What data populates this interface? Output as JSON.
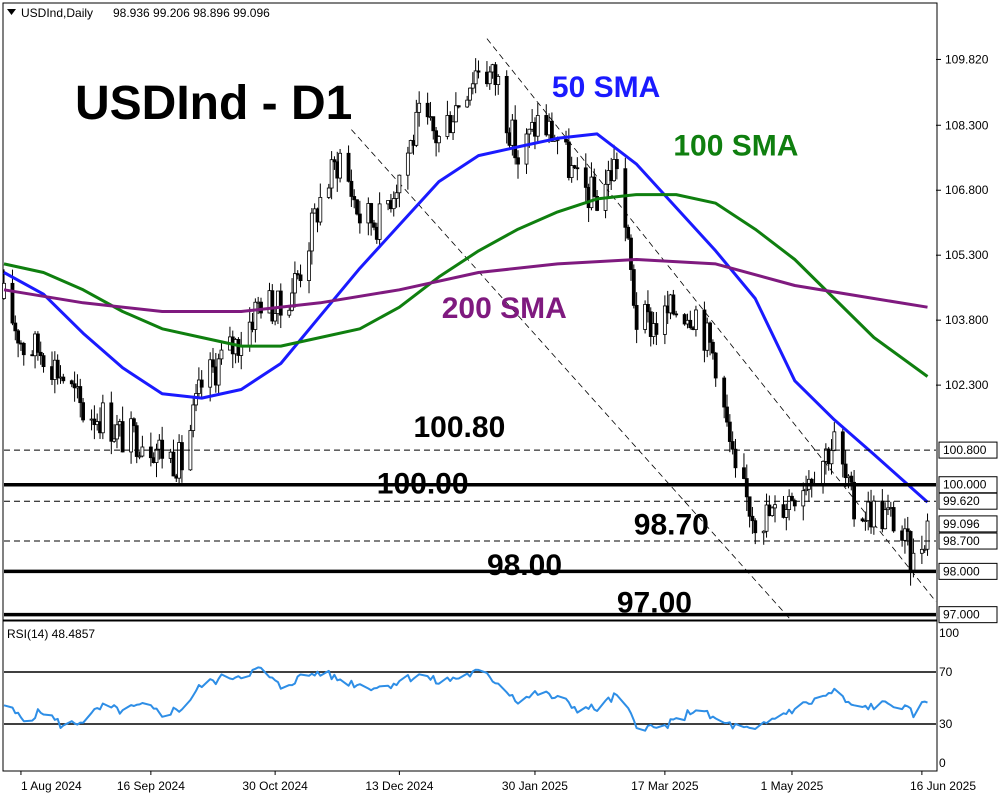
{
  "header": {
    "symbol_line": "USDInd,Daily",
    "ohlc": "98.936 99.206 98.896 99.096"
  },
  "title": "USDInd - D1",
  "colors": {
    "sma50": "#1a1aff",
    "sma100": "#0f7f0f",
    "sma200": "#7f1a7f",
    "rsi": "#2e8ee6",
    "candle": "#000000"
  },
  "chart_data": [
    {
      "type": "candlestick",
      "title": "USDInd - D1",
      "ylim": [
        96.9,
        111.1
      ],
      "y_ticks": [
        {
          "value": 109.82,
          "label": "109.820"
        },
        {
          "value": 108.3,
          "label": "108.300"
        },
        {
          "value": 106.8,
          "label": "106.800"
        },
        {
          "value": 105.3,
          "label": "105.300"
        },
        {
          "value": 103.8,
          "label": "103.800"
        },
        {
          "value": 102.3,
          "label": "102.300"
        }
      ],
      "level_boxes": [
        {
          "value": 100.8,
          "label": "100.800",
          "style": "dashed"
        },
        {
          "value": 100.0,
          "label": "100.000",
          "style": "thick"
        },
        {
          "value": 99.62,
          "label": "99.620",
          "style": "dashed"
        },
        {
          "value": 99.096,
          "label": "99.096",
          "style": "current"
        },
        {
          "value": 98.7,
          "label": "98.700",
          "style": "dashed"
        },
        {
          "value": 98.0,
          "label": "98.000",
          "style": "thick"
        },
        {
          "value": 97.0,
          "label": "97.000",
          "style": "thick"
        }
      ],
      "annotations": [
        {
          "text": "50 SMA",
          "color": "#1a1aff",
          "x_date": "2025-02-05",
          "y": 108.95
        },
        {
          "text": "100 SMA",
          "color": "#0f7f0f",
          "x_date": "2025-03-20",
          "y": 107.6
        },
        {
          "text": "200 SMA",
          "color": "#7f1a7f",
          "x_date": "2024-12-28",
          "y": 103.85
        },
        {
          "text": "100.80",
          "color": "#000000",
          "x_date": "2024-12-18",
          "y": 101.1
        },
        {
          "text": "100.00",
          "color": "#000000",
          "x_date": "2024-12-05",
          "y": 99.8
        },
        {
          "text": "98.70",
          "color": "#000000",
          "x_date": "2025-03-06",
          "y": 98.85
        },
        {
          "text": "98.00",
          "color": "#000000",
          "x_date": "2025-01-13",
          "y": 97.92
        },
        {
          "text": "97.00",
          "color": "#000000",
          "x_date": "2025-02-28",
          "y": 97.05
        }
      ],
      "x_labels": [
        "1 Aug 2024",
        "16 Sep 2024",
        "30 Oct 2024",
        "13 Dec 2024",
        "30 Jan 2025",
        "17 Mar 2025",
        "1 May 2025",
        "16 Jun 2025"
      ],
      "trend_lines": [
        {
          "from": {
            "date": "2024-11-26",
            "value": 108.2
          },
          "to": {
            "date": "2025-05-01",
            "value": 96.85
          }
        },
        {
          "from": {
            "date": "2025-01-13",
            "value": 110.3
          },
          "to": {
            "date": "2025-06-21",
            "value": 97.3
          }
        }
      ],
      "series": [
        {
          "name": "USDInd",
          "kind": "close",
          "values": [
            {
              "date": "2024-07-26",
              "value": 104.3
            },
            {
              "date": "2024-08-02",
              "value": 103.2
            },
            {
              "date": "2024-08-09",
              "value": 103.1
            },
            {
              "date": "2024-08-16",
              "value": 102.5
            },
            {
              "date": "2024-08-23",
              "value": 101.7
            },
            {
              "date": "2024-08-30",
              "value": 101.6
            },
            {
              "date": "2024-09-06",
              "value": 101.1
            },
            {
              "date": "2024-09-13",
              "value": 101.1
            },
            {
              "date": "2024-09-20",
              "value": 100.8
            },
            {
              "date": "2024-09-27",
              "value": 100.5
            },
            {
              "date": "2024-10-04",
              "value": 102.3
            },
            {
              "date": "2024-10-11",
              "value": 102.9
            },
            {
              "date": "2024-10-18",
              "value": 103.4
            },
            {
              "date": "2024-10-25",
              "value": 104.3
            },
            {
              "date": "2024-11-01",
              "value": 104.0
            },
            {
              "date": "2024-11-08",
              "value": 105.0
            },
            {
              "date": "2024-11-15",
              "value": 106.6
            },
            {
              "date": "2024-11-22",
              "value": 107.6
            },
            {
              "date": "2024-11-29",
              "value": 106.2
            },
            {
              "date": "2024-12-06",
              "value": 106.1
            },
            {
              "date": "2024-12-13",
              "value": 107.2
            },
            {
              "date": "2024-12-20",
              "value": 108.4
            },
            {
              "date": "2024-12-27",
              "value": 108.0
            },
            {
              "date": "2025-01-03",
              "value": 108.9
            },
            {
              "date": "2025-01-10",
              "value": 109.7
            },
            {
              "date": "2025-01-17",
              "value": 109.3
            },
            {
              "date": "2025-01-24",
              "value": 107.5
            },
            {
              "date": "2025-01-31",
              "value": 108.4
            },
            {
              "date": "2025-02-07",
              "value": 108.0
            },
            {
              "date": "2025-02-14",
              "value": 106.9
            },
            {
              "date": "2025-02-21",
              "value": 106.6
            },
            {
              "date": "2025-02-28",
              "value": 107.5
            },
            {
              "date": "2025-03-07",
              "value": 103.8
            },
            {
              "date": "2025-03-14",
              "value": 103.7
            },
            {
              "date": "2025-03-21",
              "value": 104.1
            },
            {
              "date": "2025-03-28",
              "value": 104.0
            },
            {
              "date": "2025-04-04",
              "value": 102.9
            },
            {
              "date": "2025-04-11",
              "value": 100.1
            },
            {
              "date": "2025-04-18",
              "value": 99.3
            },
            {
              "date": "2025-04-25",
              "value": 99.3
            },
            {
              "date": "2025-05-02",
              "value": 99.9
            },
            {
              "date": "2025-05-09",
              "value": 100.4
            },
            {
              "date": "2025-05-16",
              "value": 101.0
            },
            {
              "date": "2025-05-23",
              "value": 99.4
            },
            {
              "date": "2025-05-30",
              "value": 99.4
            },
            {
              "date": "2025-06-06",
              "value": 99.2
            },
            {
              "date": "2025-06-13",
              "value": 98.2
            },
            {
              "date": "2025-06-18",
              "value": 99.1
            }
          ]
        },
        {
          "name": "50 SMA",
          "kind": "line",
          "color": "#1a1aff",
          "values": [
            {
              "date": "2024-07-26",
              "value": 104.9
            },
            {
              "date": "2024-08-09",
              "value": 104.4
            },
            {
              "date": "2024-08-23",
              "value": 103.5
            },
            {
              "date": "2024-09-06",
              "value": 102.7
            },
            {
              "date": "2024-09-20",
              "value": 102.1
            },
            {
              "date": "2024-10-04",
              "value": 102.0
            },
            {
              "date": "2024-10-18",
              "value": 102.2
            },
            {
              "date": "2024-11-01",
              "value": 102.8
            },
            {
              "date": "2024-11-15",
              "value": 103.9
            },
            {
              "date": "2024-11-29",
              "value": 105.0
            },
            {
              "date": "2024-12-13",
              "value": 106.0
            },
            {
              "date": "2024-12-27",
              "value": 107.0
            },
            {
              "date": "2025-01-10",
              "value": 107.6
            },
            {
              "date": "2025-01-24",
              "value": 107.8
            },
            {
              "date": "2025-02-07",
              "value": 108.0
            },
            {
              "date": "2025-02-21",
              "value": 108.1
            },
            {
              "date": "2025-03-07",
              "value": 107.4
            },
            {
              "date": "2025-03-21",
              "value": 106.4
            },
            {
              "date": "2025-04-04",
              "value": 105.4
            },
            {
              "date": "2025-04-18",
              "value": 104.3
            },
            {
              "date": "2025-05-02",
              "value": 102.4
            },
            {
              "date": "2025-05-16",
              "value": 101.5
            },
            {
              "date": "2025-05-30",
              "value": 100.7
            },
            {
              "date": "2025-06-18",
              "value": 99.6
            }
          ]
        },
        {
          "name": "100 SMA",
          "kind": "line",
          "color": "#0f7f0f",
          "values": [
            {
              "date": "2024-07-26",
              "value": 105.1
            },
            {
              "date": "2024-08-09",
              "value": 104.9
            },
            {
              "date": "2024-08-23",
              "value": 104.5
            },
            {
              "date": "2024-09-06",
              "value": 104.0
            },
            {
              "date": "2024-09-20",
              "value": 103.6
            },
            {
              "date": "2024-10-04",
              "value": 103.4
            },
            {
              "date": "2024-10-18",
              "value": 103.2
            },
            {
              "date": "2024-11-01",
              "value": 103.2
            },
            {
              "date": "2024-11-15",
              "value": 103.4
            },
            {
              "date": "2024-11-29",
              "value": 103.6
            },
            {
              "date": "2024-12-13",
              "value": 104.1
            },
            {
              "date": "2024-12-27",
              "value": 104.8
            },
            {
              "date": "2025-01-10",
              "value": 105.4
            },
            {
              "date": "2025-01-24",
              "value": 105.9
            },
            {
              "date": "2025-02-07",
              "value": 106.3
            },
            {
              "date": "2025-02-21",
              "value": 106.6
            },
            {
              "date": "2025-03-07",
              "value": 106.7
            },
            {
              "date": "2025-03-21",
              "value": 106.7
            },
            {
              "date": "2025-04-04",
              "value": 106.5
            },
            {
              "date": "2025-04-18",
              "value": 105.9
            },
            {
              "date": "2025-05-02",
              "value": 105.2
            },
            {
              "date": "2025-05-16",
              "value": 104.3
            },
            {
              "date": "2025-05-30",
              "value": 103.4
            },
            {
              "date": "2025-06-18",
              "value": 102.5
            }
          ]
        },
        {
          "name": "200 SMA",
          "kind": "line",
          "color": "#7f1a7f",
          "values": [
            {
              "date": "2024-07-26",
              "value": 104.5
            },
            {
              "date": "2024-08-23",
              "value": 104.2
            },
            {
              "date": "2024-09-20",
              "value": 104.0
            },
            {
              "date": "2024-10-18",
              "value": 104.0
            },
            {
              "date": "2024-11-15",
              "value": 104.2
            },
            {
              "date": "2024-12-13",
              "value": 104.5
            },
            {
              "date": "2025-01-10",
              "value": 104.9
            },
            {
              "date": "2025-02-07",
              "value": 105.1
            },
            {
              "date": "2025-03-07",
              "value": 105.2
            },
            {
              "date": "2025-04-04",
              "value": 105.1
            },
            {
              "date": "2025-05-02",
              "value": 104.6
            },
            {
              "date": "2025-05-30",
              "value": 104.3
            },
            {
              "date": "2025-06-18",
              "value": 104.1
            }
          ]
        }
      ]
    },
    {
      "type": "line",
      "title": "RSI(14) 48.4857",
      "indicator": "RSI(14)",
      "current_value": "48.4857",
      "ylim": [
        0,
        100
      ],
      "y_ticks": [
        {
          "value": 100,
          "label": "100"
        },
        {
          "value": 70,
          "label": "70"
        },
        {
          "value": 30,
          "label": "30"
        },
        {
          "value": 0,
          "label": "0"
        }
      ],
      "levels": [
        70,
        30
      ],
      "series": [
        {
          "name": "RSI(14)",
          "color": "#2e8ee6",
          "values": [
            {
              "date": "2024-07-26",
              "value": 45
            },
            {
              "date": "2024-08-02",
              "value": 33
            },
            {
              "date": "2024-08-09",
              "value": 40
            },
            {
              "date": "2024-08-16",
              "value": 28
            },
            {
              "date": "2024-08-23",
              "value": 33
            },
            {
              "date": "2024-08-30",
              "value": 43
            },
            {
              "date": "2024-09-06",
              "value": 40
            },
            {
              "date": "2024-09-13",
              "value": 44
            },
            {
              "date": "2024-09-20",
              "value": 38
            },
            {
              "date": "2024-09-27",
              "value": 42
            },
            {
              "date": "2024-10-04",
              "value": 60
            },
            {
              "date": "2024-10-11",
              "value": 65
            },
            {
              "date": "2024-10-18",
              "value": 68
            },
            {
              "date": "2024-10-25",
              "value": 72
            },
            {
              "date": "2024-11-01",
              "value": 58
            },
            {
              "date": "2024-11-08",
              "value": 66
            },
            {
              "date": "2024-11-15",
              "value": 70
            },
            {
              "date": "2024-11-22",
              "value": 64
            },
            {
              "date": "2024-11-29",
              "value": 60
            },
            {
              "date": "2024-12-06",
              "value": 58
            },
            {
              "date": "2024-12-13",
              "value": 63
            },
            {
              "date": "2024-12-20",
              "value": 68
            },
            {
              "date": "2024-12-27",
              "value": 62
            },
            {
              "date": "2025-01-03",
              "value": 66
            },
            {
              "date": "2025-01-10",
              "value": 70
            },
            {
              "date": "2025-01-17",
              "value": 62
            },
            {
              "date": "2025-01-24",
              "value": 48
            },
            {
              "date": "2025-01-31",
              "value": 54
            },
            {
              "date": "2025-02-07",
              "value": 50
            },
            {
              "date": "2025-02-14",
              "value": 42
            },
            {
              "date": "2025-02-21",
              "value": 42
            },
            {
              "date": "2025-02-28",
              "value": 52
            },
            {
              "date": "2025-03-07",
              "value": 30
            },
            {
              "date": "2025-03-14",
              "value": 26
            },
            {
              "date": "2025-03-21",
              "value": 32
            },
            {
              "date": "2025-03-28",
              "value": 42
            },
            {
              "date": "2025-04-04",
              "value": 33
            },
            {
              "date": "2025-04-11",
              "value": 28
            },
            {
              "date": "2025-04-18",
              "value": 24
            },
            {
              "date": "2025-04-25",
              "value": 35
            },
            {
              "date": "2025-05-02",
              "value": 42
            },
            {
              "date": "2025-05-09",
              "value": 48
            },
            {
              "date": "2025-05-16",
              "value": 55
            },
            {
              "date": "2025-05-23",
              "value": 42
            },
            {
              "date": "2025-05-30",
              "value": 44
            },
            {
              "date": "2025-06-06",
              "value": 46
            },
            {
              "date": "2025-06-13",
              "value": 38
            },
            {
              "date": "2025-06-18",
              "value": 48
            }
          ]
        }
      ]
    }
  ]
}
